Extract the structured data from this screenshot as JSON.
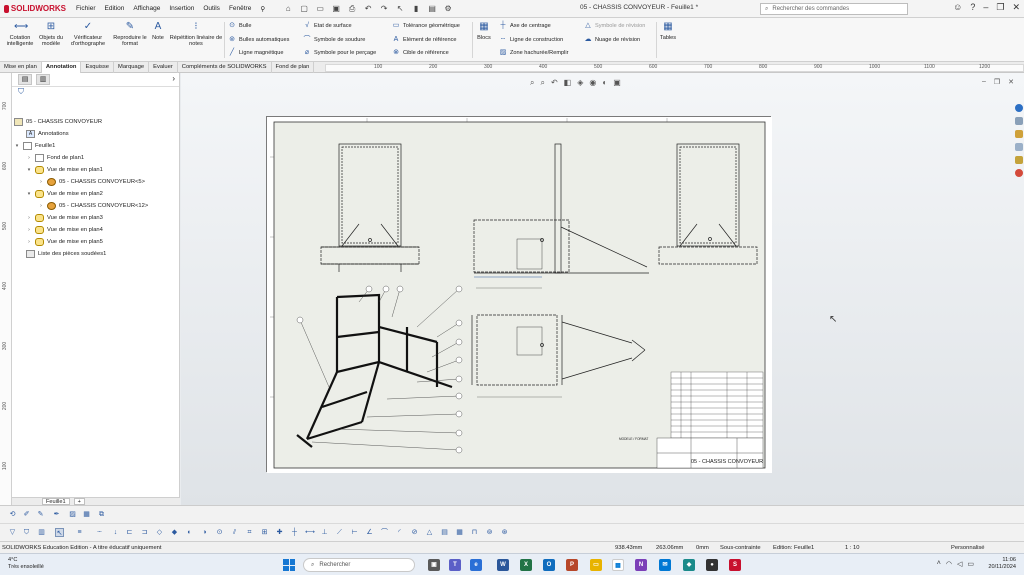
{
  "app": {
    "logo": "SOLIDWORKS",
    "doc_title": "05 - CHASSIS CONVOYEUR - Feuille1 *"
  },
  "menu": [
    "Fichier",
    "Edition",
    "Affichage",
    "Insertion",
    "Outils",
    "Fenêtre"
  ],
  "search": {
    "placeholder": "Rechercher des commandes"
  },
  "ribbon": {
    "cotation": "Cotation intelligente",
    "objets": "Objets du modèle",
    "verif": "Vérificateur d'orthographe",
    "reproduire": "Reproduire le format",
    "note": "Note",
    "repetition": "Répétition linéaire de notes",
    "bulle": "Bulle",
    "bulles_auto": "Bulles automatiques",
    "ligne_mag": "Ligne magnétique",
    "etat_surface": "Etat de surface",
    "symbole_soudure": "Symbole de soudure",
    "symbole_percage": "Symbole pour le perçage",
    "tolerance": "Tolérance géométrique",
    "element_ref": "Elément de référence",
    "cible_ref": "Cible de référence",
    "blocs": "Blocs",
    "axe_centrage": "Axe de centrage",
    "ligne_construction": "Ligne de construction",
    "zone_hachuree": "Zone hachurée/Remplir",
    "symbole_revision": "Symbole de révision",
    "nuage_revision": "Nuage de révision",
    "tables": "Tables"
  },
  "tabs": [
    "Mise en plan",
    "Annotation",
    "Esquisse",
    "Marquage",
    "Evaluer",
    "Compléments de SOLIDWORKS",
    "Fond de plan"
  ],
  "active_tab": "Annotation",
  "ruler": [
    "100",
    "200",
    "300",
    "400",
    "500",
    "600",
    "700",
    "800",
    "900",
    "1000",
    "1100",
    "1200"
  ],
  "vruler": [
    "700",
    "600",
    "500",
    "400",
    "300",
    "200",
    "100"
  ],
  "tree": {
    "root": "05 - CHASSIS CONVOYEUR",
    "annotations": "Annotations",
    "sheet": "Feuille1",
    "fond": "Fond de plan1",
    "view1": "Vue de mise en plan1",
    "part1": "05 - CHASSIS CONVOYEUR<5>",
    "view2": "Vue de mise en plan2",
    "part2": "05 - CHASSIS CONVOYEUR<12>",
    "view3": "Vue de mise en plan3",
    "view4": "Vue de mise en plan4",
    "view5": "Vue de mise en plan5",
    "weld_list": "Liste des pièces soudées1"
  },
  "sheet_tab": "Feuille1",
  "drawing": {
    "title_block": "05 - CHASSIS CONVOYEUR",
    "iso_label": "MODELE / FORMAT"
  },
  "status": {
    "edition": "SOLIDWORKS Education Edition - A titre éducatif uniquement",
    "x": "938.43mm",
    "y": "263.06mm",
    "z": "0mm",
    "state": "Sous-contrainte",
    "editing": "Edition: Feuille1",
    "scale": "1 : 10",
    "units": "Personnalisé"
  },
  "taskbar": {
    "temp": "4°C",
    "weather": "Très ensoleillé",
    "search": "Rechercher",
    "time": "11:06",
    "date": "20/11/2024"
  }
}
